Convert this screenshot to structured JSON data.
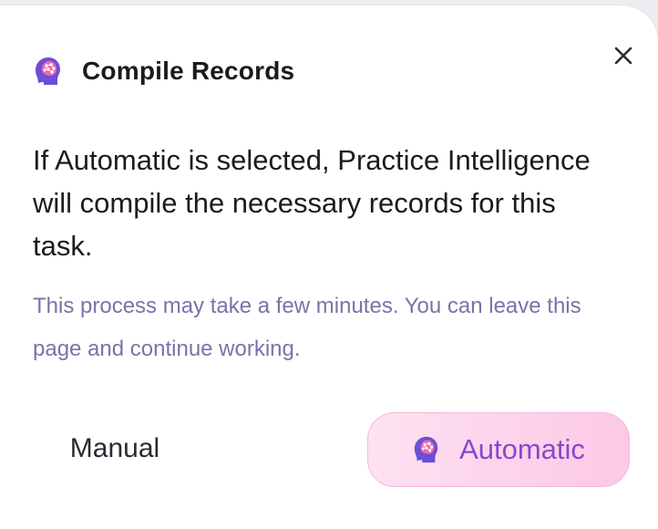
{
  "dialog": {
    "title": "Compile Records",
    "title_icon": "brain-head-icon",
    "close_icon": "close-icon",
    "body": "If Automatic is selected, Practice Intelligence will compile the necessary records for this task.",
    "note": "This process may take a few minutes. You can leave this page and continue working.",
    "buttons": {
      "manual_label": "Manual",
      "automatic_label": "Automatic",
      "automatic_icon": "brain-head-icon"
    }
  },
  "colors": {
    "title": "#1a1a1f",
    "note": "#7a73a8",
    "automatic_text": "#8a47d0",
    "automatic_bg_start": "#fde2f1",
    "automatic_bg_end": "#fcc8e6",
    "icon_purple": "#6b4fd8",
    "icon_pink": "#f06aa8"
  }
}
